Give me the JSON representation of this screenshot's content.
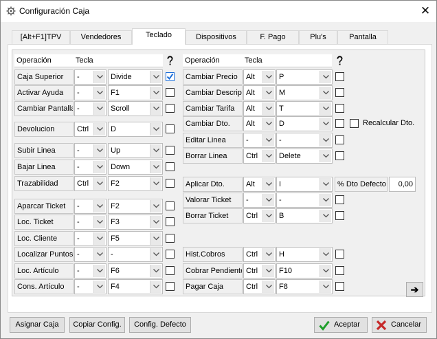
{
  "window": {
    "title": "Configuración Caja",
    "close_glyph": "✕"
  },
  "tabs": [
    "[Alt+F1]TPV",
    "Vendedores",
    "Teclado",
    "Dispositivos",
    "F. Pago",
    "Plu's",
    "Pantalla"
  ],
  "active_tab": "Teclado",
  "headers": {
    "operacion": "Operación",
    "tecla": "Tecla",
    "help_icon": "?"
  },
  "left_rows": [
    {
      "op": "Caja Superior",
      "mod": "-",
      "key": "Divide",
      "checked": true
    },
    {
      "op": "Activar Ayuda",
      "mod": "-",
      "key": "F1",
      "checked": false
    },
    {
      "op": "Cambiar Pantalla",
      "mod": "-",
      "key": "Scroll",
      "checked": false
    },
    {
      "op": "Devolucion",
      "mod": "Ctrl",
      "key": "D",
      "checked": false
    },
    {
      "op": "Subir Linea",
      "mod": "-",
      "key": "Up",
      "checked": false
    },
    {
      "op": "Bajar Linea",
      "mod": "-",
      "key": "Down",
      "checked": false
    },
    {
      "op": "Trazabilidad",
      "mod": "Ctrl",
      "key": "F2",
      "checked": false
    },
    {
      "op": "Aparcar Ticket",
      "mod": "-",
      "key": "F2",
      "checked": false
    },
    {
      "op": "Loc. Ticket",
      "mod": "-",
      "key": "F3",
      "checked": false
    },
    {
      "op": "Loc. Cliente",
      "mod": "-",
      "key": "F5",
      "checked": false
    },
    {
      "op": "Localizar Puntos",
      "mod": "-",
      "key": "-",
      "checked": false
    },
    {
      "op": "Loc. Artículo",
      "mod": "-",
      "key": "F6",
      "checked": false
    },
    {
      "op": "Cons. Artículo",
      "mod": "-",
      "key": "F4",
      "checked": false
    }
  ],
  "right_rows": [
    {
      "op": "Cambiar Precio",
      "mod": "Alt",
      "key": "P",
      "checked": false
    },
    {
      "op": "Cambiar Descrip.",
      "mod": "Alt",
      "key": "M",
      "checked": false
    },
    {
      "op": "Cambiar Tarifa",
      "mod": "Alt",
      "key": "T",
      "checked": false
    },
    {
      "op": "Cambiar Dto.",
      "mod": "Alt",
      "key": "D",
      "checked": false
    },
    {
      "op": "Editar Linea",
      "mod": "-",
      "key": "-",
      "checked": false
    },
    {
      "op": "Borrar Linea",
      "mod": "Ctrl",
      "key": "Delete",
      "checked": false
    },
    {
      "op": "Aplicar Dto.",
      "mod": "Alt",
      "key": "I",
      "checked": false
    },
    {
      "op": "Valorar Ticket",
      "mod": "-",
      "key": "-",
      "checked": false
    },
    {
      "op": "Borrar Ticket",
      "mod": "Ctrl",
      "key": "B",
      "checked": false
    },
    {
      "op": "Hist.Cobros",
      "mod": "Ctrl",
      "key": "H",
      "checked": false
    },
    {
      "op": "Cobrar Pendiente",
      "mod": "Ctrl",
      "key": "F10",
      "checked": false
    },
    {
      "op": "Pagar Caja",
      "mod": "Ctrl",
      "key": "F8",
      "checked": false
    }
  ],
  "recalcular": {
    "label": "Recalcular Dto.",
    "checked": false
  },
  "dto_defecto": {
    "label": "% Dto Defecto",
    "value": "0,00"
  },
  "next_button_glyph": "➔",
  "buttons": {
    "asignar": "Asignar Caja",
    "copiar": "Copiar Config.",
    "defecto": "Config. Defecto",
    "aceptar": "Aceptar",
    "cancelar": "Cancelar"
  },
  "colors": {
    "accept_green": "#1e9e2a",
    "cancel_red": "#c62828",
    "check_blue": "#1e6fd9"
  }
}
